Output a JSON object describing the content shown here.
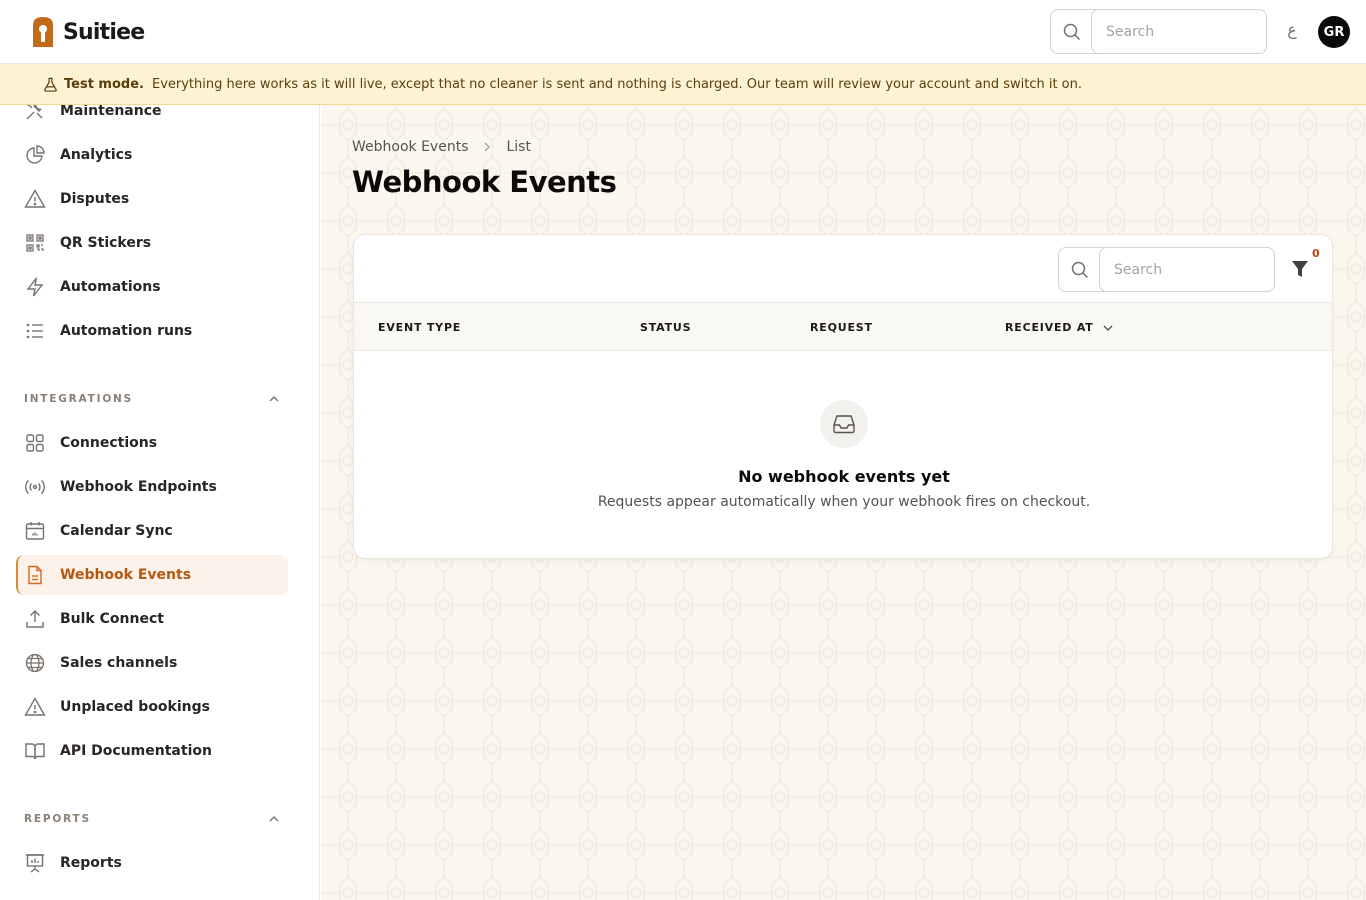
{
  "app": {
    "name": "Suitiee",
    "brand_color": "#c26a1a",
    "accent_color": "#b5570e"
  },
  "topbar": {
    "search_placeholder": "Search",
    "lang_toggle": "ع",
    "avatar_initials": "GR"
  },
  "banner": {
    "title": "Test mode.",
    "message": "Everything here works as it will live, except that no cleaner is sent and nothing is charged. Our team will review your account and switch it on."
  },
  "sidebar": {
    "items_top": [
      {
        "label": "Maintenance",
        "icon": "tools-icon"
      },
      {
        "label": "Analytics",
        "icon": "pie-chart-icon"
      },
      {
        "label": "Disputes",
        "icon": "warning-icon"
      },
      {
        "label": "QR Stickers",
        "icon": "qr-code-icon"
      },
      {
        "label": "Automations",
        "icon": "lightning-icon"
      },
      {
        "label": "Automation runs",
        "icon": "list-icon"
      }
    ],
    "integrations": {
      "heading": "INTEGRATIONS",
      "items": [
        {
          "label": "Connections",
          "icon": "grid-icon"
        },
        {
          "label": "Webhook Endpoints",
          "icon": "broadcast-icon"
        },
        {
          "label": "Calendar Sync",
          "icon": "calendar-icon"
        },
        {
          "label": "Webhook Events",
          "icon": "document-icon",
          "active": true
        },
        {
          "label": "Bulk Connect",
          "icon": "upload-icon"
        },
        {
          "label": "Sales channels",
          "icon": "globe-icon"
        },
        {
          "label": "Unplaced bookings",
          "icon": "warning-icon"
        },
        {
          "label": "API Documentation",
          "icon": "book-icon"
        }
      ]
    },
    "reports": {
      "heading": "REPORTS",
      "items": [
        {
          "label": "Reports",
          "icon": "presentation-icon"
        }
      ]
    }
  },
  "main": {
    "breadcrumb": [
      "Webhook Events",
      "List"
    ],
    "title": "Webhook Events",
    "table": {
      "search_placeholder": "Search",
      "filter_count": "0",
      "columns": [
        "EVENT TYPE",
        "STATUS",
        "REQUEST",
        "RECEIVED AT"
      ],
      "rows": [],
      "empty_title": "No webhook events yet",
      "empty_subtitle": "Requests appear automatically when your webhook fires on checkout."
    }
  }
}
